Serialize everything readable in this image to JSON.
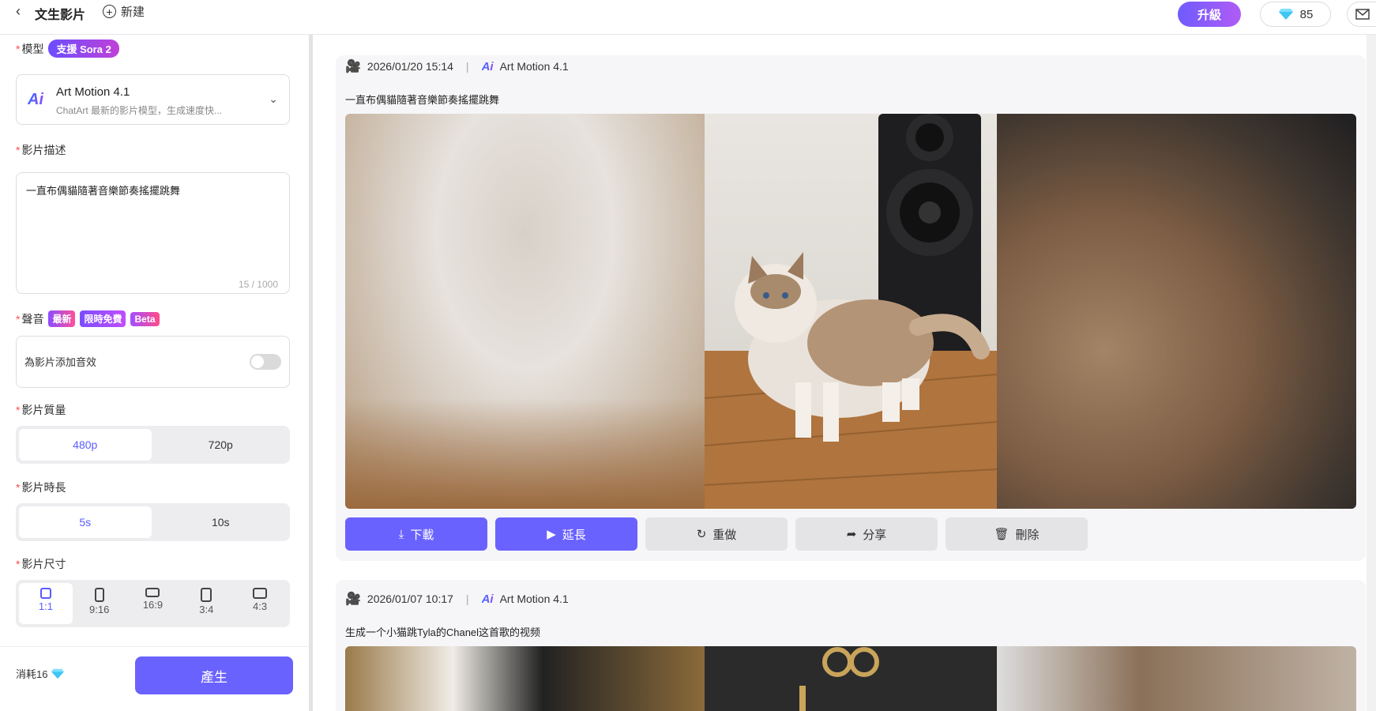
{
  "header": {
    "title": "文生影片",
    "new_label": "新建",
    "upgrade_label": "升級",
    "gem_count": "85"
  },
  "sidebar": {
    "model_label": "模型",
    "model_badge": "支援 Sora 2",
    "model_name": "Art Motion 4.1",
    "model_desc": "ChatArt 最新的影片模型，生成速度快...",
    "desc_label": "影片描述",
    "desc_value": "一直布偶貓隨著音樂節奏搖擺跳舞",
    "desc_counter": "15 / 1000",
    "sound_label": "聲音",
    "sound_tags": [
      "最新",
      "限時免費",
      "Beta"
    ],
    "sound_toggle_text": "為影片添加音效",
    "quality_label": "影片質量",
    "quality_options": [
      "480p",
      "720p"
    ],
    "duration_label": "影片時長",
    "duration_options": [
      "5s",
      "10s"
    ],
    "size_label": "影片尺寸",
    "size_options": [
      "1:1",
      "9:16",
      "16:9",
      "3:4",
      "4:3"
    ],
    "cost_label": "消耗16",
    "generate_label": "產生"
  },
  "cards": [
    {
      "timestamp": "2026/01/20 15:14",
      "model": "Art Motion 4.1",
      "prompt": "一直布偶貓隨著音樂節奏搖擺跳舞",
      "actions": [
        "下載",
        "延長",
        "重做",
        "分享",
        "刪除"
      ]
    },
    {
      "timestamp": "2026/01/07 10:17",
      "model": "Art Motion 4.1",
      "prompt": "生成一个小猫跳Tyla的Chanel这首歌的视频"
    }
  ],
  "colors": {
    "accent": "#6a62ff",
    "required": "#ff4d4f"
  }
}
